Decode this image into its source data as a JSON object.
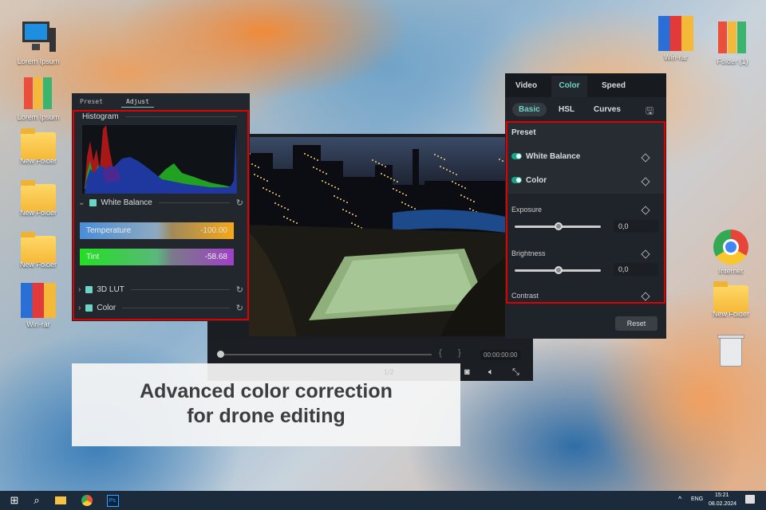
{
  "desktop_left": [
    {
      "label": "Lorem Ipsum",
      "icon": "computer"
    },
    {
      "label": "Lorem Ipsum",
      "icon": "binders"
    },
    {
      "label": "New Folder",
      "icon": "folder"
    },
    {
      "label": "New Folder",
      "icon": "folder"
    },
    {
      "label": "New Folder",
      "icon": "folder"
    },
    {
      "label": "Win-rar",
      "icon": "winrar"
    }
  ],
  "desktop_right": [
    {
      "label": "Win-rar",
      "icon": "winrar"
    },
    {
      "label": "Folder (1)",
      "icon": "binders"
    },
    {
      "label": "Internet",
      "icon": "chrome"
    },
    {
      "label": "New Folder",
      "icon": "folder"
    },
    {
      "label": "",
      "icon": "trash"
    }
  ],
  "left_panel": {
    "tabs": [
      "Preset",
      "Adjust"
    ],
    "active_tab": "Adjust",
    "histogram_label": "Histogram",
    "white_balance": "White Balance",
    "temperature_label": "Temperature",
    "temperature_value": "-100.00",
    "tint_label": "Tint",
    "tint_value": "-58.68",
    "lut": "3D LUT",
    "color": "Color"
  },
  "right_panel": {
    "tabs": [
      "Video",
      "Color",
      "Speed"
    ],
    "active_tab": "Color",
    "subtabs": [
      "Basic",
      "HSL",
      "Curves"
    ],
    "active_subtab": "Basic",
    "preset": "Preset",
    "white_balance": "White Balance",
    "color": "Color",
    "exposure": "Exposure",
    "exposure_value": "0,0",
    "brightness": "Brightness",
    "brightness_value": "0,0",
    "contrast": "Contrast",
    "reset": "Reset"
  },
  "player": {
    "timecode": "00:00:00:00",
    "progress": 0,
    "page": "1/2"
  },
  "caption": {
    "line1": "Advanced color correction",
    "line2": "for drone editing"
  },
  "taskbar": {
    "lang": "ENG",
    "time": "15:21",
    "date": "08.02.2024"
  },
  "colors": {
    "accent": "#17a58a",
    "highlight": "#e00000"
  }
}
